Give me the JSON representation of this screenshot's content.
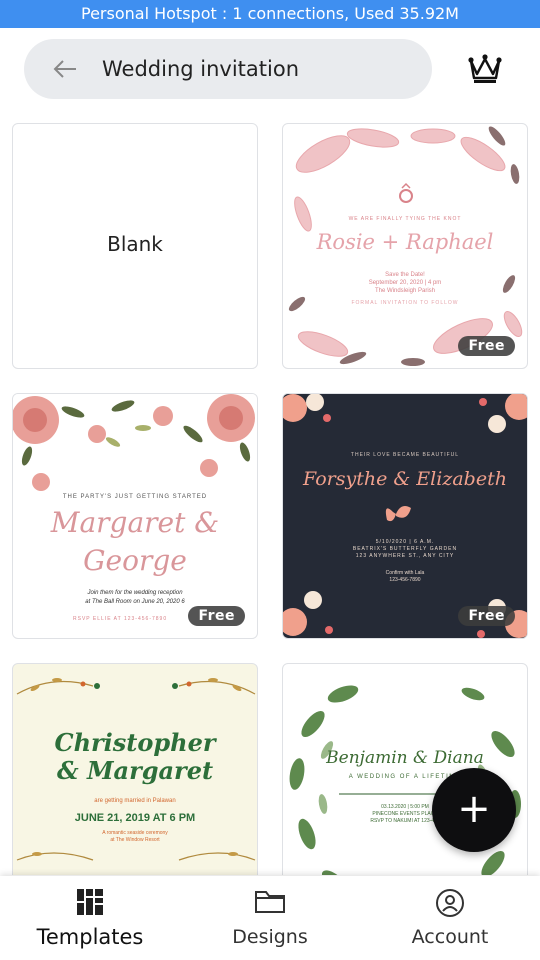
{
  "status_bar": {
    "text": "Personal Hotspot : 1 connections, Used 35.92M"
  },
  "search": {
    "query": "Wedding invitation",
    "back_icon": "arrow-left-icon"
  },
  "header": {
    "premium_icon": "crown-icon"
  },
  "templates": {
    "blank": {
      "label": "Blank"
    },
    "rosie": {
      "header": "WE ARE FINALLY TYING THE KNOT",
      "names": "Rosie + Raphael",
      "line1": "Save the Date!",
      "line2": "September 20, 2020 | 4 pm",
      "line3": "The Windsleigh Parish",
      "line4": "FORMAL INVITATION TO FOLLOW",
      "badge": "Free"
    },
    "margaret": {
      "header": "THE PARTY'S JUST GETTING STARTED",
      "names1": "Margaret &",
      "names2": "George",
      "line1": "Join them for the wedding reception",
      "line2": "at The Ball Room on June 20, 2020 6",
      "rsvp": "RSVP ELLIE AT 123-456-7890",
      "badge": "Free"
    },
    "forsythe": {
      "header": "THEIR LOVE BECAME BEAUTIFUL",
      "names": "Forsythe & Elizabeth",
      "line1": "5/10/2020 | 6 A.M.",
      "line2": "BEATRIX'S BUTTERFLY GARDEN",
      "line3": "123 ANYWHERE ST., ANY CITY",
      "line4": "Confirm with Lala",
      "line5": "123-456-7890",
      "badge": "Free"
    },
    "christopher": {
      "names1": "Christopher",
      "names2": "& Margaret",
      "line1": "are getting married in Palawan",
      "date": "JUNE 21, 2019 AT 6 PM",
      "line2": "A romantic seaside ceremony",
      "line3": "at The Window Resort"
    },
    "benjamin": {
      "names": "Benjamin & Diana",
      "line1": "A WEDDING OF A LIFETIME",
      "line2": "03.13.2020 | 5:00 PM",
      "line3": "PINECONE EVENTS PLACE",
      "line4": "RSVP TO NAKUMI AT 123-456"
    }
  },
  "fab": {
    "label": "+"
  },
  "nav": {
    "templates": {
      "label": "Templates",
      "icon": "templates-grid-icon"
    },
    "designs": {
      "label": "Designs",
      "icon": "folder-icon"
    },
    "account": {
      "label": "Account",
      "icon": "account-circle-icon"
    }
  },
  "colors": {
    "status_bar": "#3f8ff0",
    "search_bg": "#e9ebee",
    "fab": "#0e0e10",
    "pink": "#d9838a",
    "navy": "#252a36",
    "green": "#2d6f3a"
  }
}
